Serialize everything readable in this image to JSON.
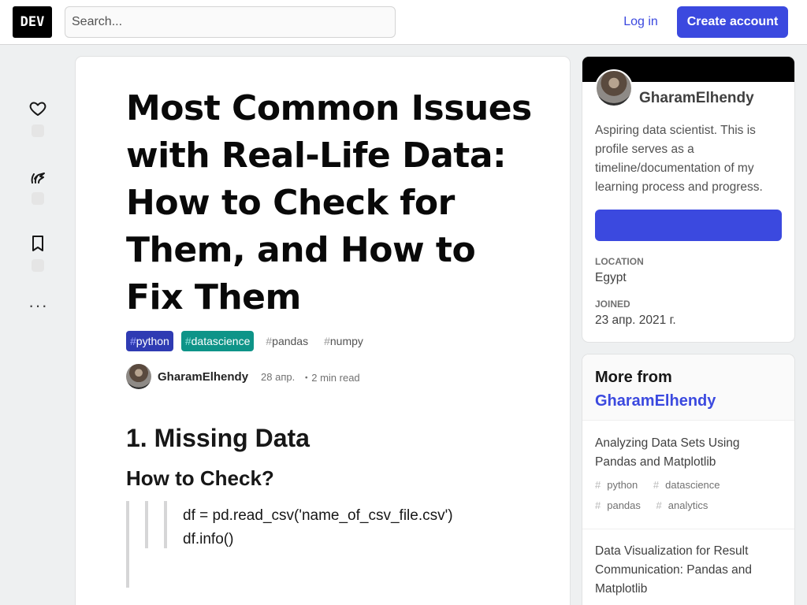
{
  "header": {
    "logo": "DEV",
    "search_placeholder": "Search...",
    "login_label": "Log in",
    "create_account_label": "Create account"
  },
  "article": {
    "title": "Most Common Issues with Real-Life Data: How to Check for Them, and How to Fix Them",
    "tags": [
      {
        "hash": "#",
        "name": "python"
      },
      {
        "hash": "#",
        "name": "datascience"
      },
      {
        "hash": "#",
        "name": "pandas"
      },
      {
        "hash": "#",
        "name": "numpy"
      }
    ],
    "author": "GharamElhendy",
    "date": "28 апр.",
    "read_time": "・2 min read",
    "heading1": "1. Missing Data",
    "heading2": "How to Check?",
    "code_line1": "df = pd.read_csv('name_of_csv_file.csv')",
    "code_line2": "df.info()"
  },
  "profile": {
    "name": "GharamElhendy",
    "bio": "Aspiring data scientist. This is profile serves as a timeline/documentation of my learning process and progress.",
    "location_label": "LOCATION",
    "location": "Egypt",
    "joined_label": "JOINED",
    "joined": "23 апр. 2021 г."
  },
  "more_from": {
    "heading": "More from",
    "author_link": "GharamElhendy",
    "items": [
      {
        "title": "Analyzing Data Sets Using Pandas and Matplotlib",
        "tags": [
          "python",
          "datascience",
          "pandas",
          "analytics"
        ]
      },
      {
        "title": "Data Visualization for Result Communication: Pandas and Matplotlib",
        "tags": []
      }
    ]
  }
}
